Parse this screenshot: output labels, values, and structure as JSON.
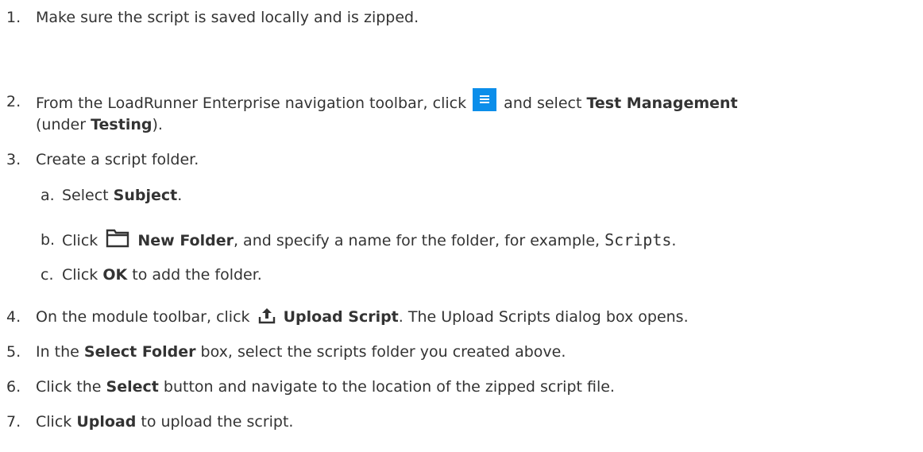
{
  "steps": [
    {
      "num": "1.",
      "text": "Make sure the script is saved locally and is zipped."
    },
    {
      "num": "2.",
      "pre": "From the LoadRunner Enterprise navigation toolbar, click",
      "mid": "and select",
      "bold1": "Test Management",
      "line2_pre": "(under",
      "bold2": "Testing",
      "line2_post": ")."
    },
    {
      "num": "3.",
      "text": "Create a script folder."
    },
    {
      "num": "4.",
      "pre": "On the module toolbar, click",
      "bold": "Upload Script",
      "post": ". The Upload Scripts dialog box opens."
    },
    {
      "num": "5.",
      "pre": "In the",
      "bold": "Select Folder",
      "post": "box, select the scripts folder you created above."
    },
    {
      "num": "6.",
      "pre": "Click the",
      "bold": "Select",
      "post": "button and navigate to the location of the zipped script file."
    },
    {
      "num": "7.",
      "pre": "Click",
      "bold": "Upload",
      "post": "to upload the script."
    }
  ],
  "substeps": [
    {
      "num": "a.",
      "pre": "Select",
      "bold": "Subject",
      "post": "."
    },
    {
      "num": "b.",
      "pre": "Click",
      "bold": "New Folder",
      "post": ", and specify a name for the folder, for example,",
      "code": "Scripts",
      "end": "."
    },
    {
      "num": "c.",
      "pre": "Click",
      "bold": "OK",
      "post": "to add the folder."
    }
  ],
  "icons": {
    "menu": "hamburger-menu-icon",
    "folder": "folder-icon",
    "upload": "upload-icon"
  },
  "colors": {
    "text": "#333333",
    "accent": "#0b8eea"
  }
}
